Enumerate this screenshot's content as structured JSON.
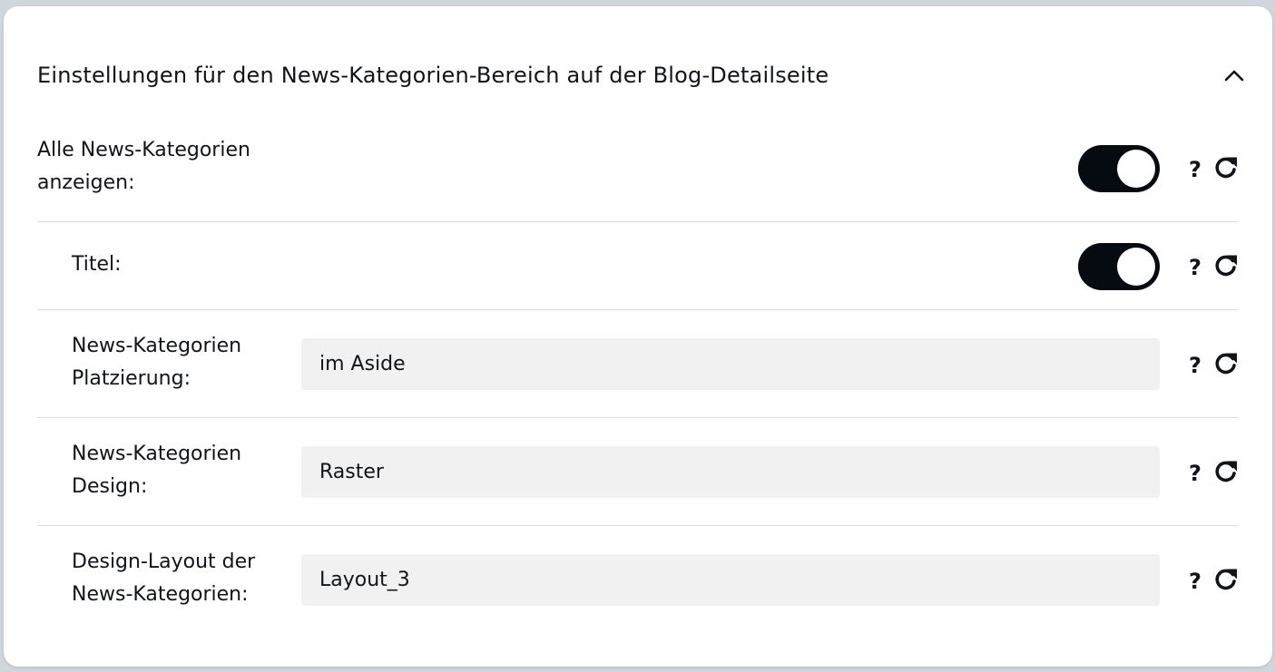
{
  "panel": {
    "title": "Einstellungen für den News-Kategorien-Bereich auf der Blog-Detailseite",
    "collapse_icon": "chevron-up-icon"
  },
  "rows": [
    {
      "label_line1": "Alle News-Kategorien",
      "label_line2": "anzeigen:",
      "control": "toggle",
      "on": true
    },
    {
      "label_line1": "Titel:",
      "label_line2": "",
      "control": "toggle",
      "on": true
    },
    {
      "label_line1": "News-Kategorien",
      "label_line2": "Platzierung:",
      "control": "select",
      "value": "im Aside"
    },
    {
      "label_line1": "News-Kategorien",
      "label_line2": "Design:",
      "control": "select",
      "value": "Raster"
    },
    {
      "label_line1": "Design-Layout der",
      "label_line2": "News-Kategorien:",
      "control": "select",
      "value": "Layout_3"
    }
  ],
  "help_symbol": "?",
  "icons": {
    "help": "question-icon",
    "reset": "refresh-icon"
  },
  "colors": {
    "toggle_on": "#060b12",
    "field_bg": "#f1f1f1",
    "divider": "#d9d9d9"
  }
}
